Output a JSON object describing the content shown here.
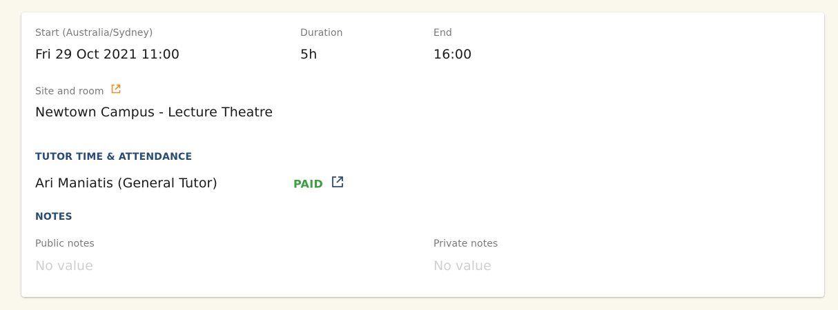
{
  "session": {
    "start_label": "Start (Australia/Sydney)",
    "start_value": "Fri 29 Oct 2021 11:00",
    "duration_label": "Duration",
    "duration_value": "5h",
    "end_label": "End",
    "end_value": "16:00",
    "site_label": "Site and room",
    "site_value": "Newtown Campus - Lecture Theatre"
  },
  "tutors": {
    "section_title": "TUTOR TIME & ATTENDANCE",
    "items": [
      {
        "name": "Ari Maniatis (General Tutor)",
        "status": "PAID"
      }
    ]
  },
  "notes": {
    "section_title": "NOTES",
    "public_label": "Public notes",
    "public_value": "No value",
    "private_label": "Private notes",
    "private_value": "No value"
  },
  "icons": {
    "site_link": "external-link-icon",
    "tutor_link": "external-link-icon"
  },
  "colors": {
    "background": "#faf7ec",
    "card": "#ffffff",
    "section_title": "#2a4a78",
    "paid": "#3aa041",
    "site_link_icon": "#f08a24",
    "tutor_link_icon": "#2a4a78",
    "empty_value": "#d0d0d0"
  }
}
